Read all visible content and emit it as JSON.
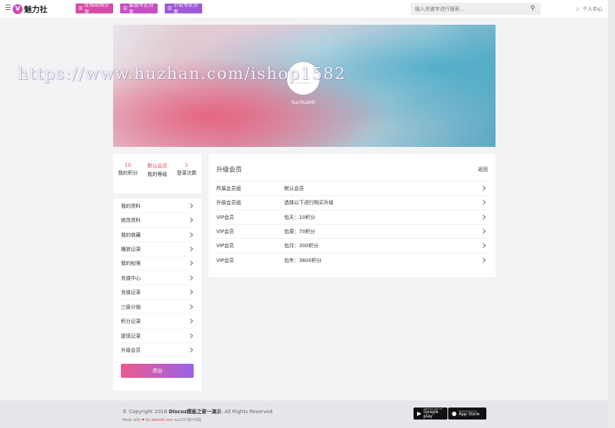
{
  "header": {
    "logo_badge": "V",
    "logo_text": "魅力社",
    "categories": [
      "在线视频分类",
      "套图专区分类",
      "小说专区分类"
    ],
    "search_placeholder": "输入关键字进行搜索...",
    "user_center": "个人中心"
  },
  "banner": {
    "watermark": "https://www.huzhan.com/ishop1582",
    "username": "liuchuanli"
  },
  "stats": [
    {
      "value": "10",
      "label": "我的积分"
    },
    {
      "value": "默认会员",
      "label": "我的等级"
    },
    {
      "value": "1",
      "label": "登录次数"
    }
  ],
  "menu": {
    "items": [
      "我的资料",
      "修改资料",
      "我的收藏",
      "播放记录",
      "我的权限",
      "充值中心",
      "充值记录",
      "三级分销",
      "积分记录",
      "提现记录",
      "升级会员"
    ],
    "logout": "退出"
  },
  "panel": {
    "title": "升级会员",
    "back": "返回",
    "rows": [
      {
        "left": "所属会员组",
        "right": "默认会员"
      },
      {
        "left": "升级会员组",
        "right": "选择以下进行购买升级"
      },
      {
        "left": "VIP会员",
        "right": "包天：10积分"
      },
      {
        "left": "VIP会员",
        "right": "包周：70积分"
      },
      {
        "left": "VIP会员",
        "right": "包月：300积分"
      },
      {
        "left": "VIP会员",
        "right": "包年：3600积分"
      }
    ]
  },
  "footer": {
    "copyright_prefix": "© Copyright 2018 ",
    "copyright_site": "Discuz模板之家一演示",
    "copyright_suffix": ". All Rights Reserved",
    "made_with": "Made with",
    "by": "by",
    "made_link": "wtdsoft.com",
    "icp": "icp123 统计代码",
    "google_small": "ANDROID APP ON",
    "google_big": "Google play",
    "apple_small": "Download on the",
    "apple_big": "App Store"
  },
  "colors": {
    "accent": "#e9484f",
    "cat1": "#d64ba8",
    "cat2": "#c64fc3",
    "cat3": "#9e5ad8"
  }
}
